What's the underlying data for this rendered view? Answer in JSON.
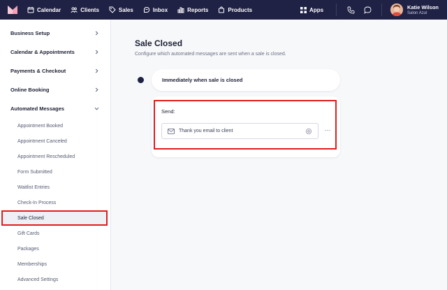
{
  "nav": {
    "items": [
      {
        "label": "Calendar",
        "icon": "calendar-icon"
      },
      {
        "label": "Clients",
        "icon": "users-icon"
      },
      {
        "label": "Sales",
        "icon": "tag-icon"
      },
      {
        "label": "Inbox",
        "icon": "inbox-icon"
      },
      {
        "label": "Reports",
        "icon": "bar-chart-icon"
      },
      {
        "label": "Products",
        "icon": "bag-icon"
      }
    ],
    "apps_label": "Apps",
    "user": {
      "name": "Katie Wilson",
      "business": "Salon Azul"
    }
  },
  "sidebar": {
    "sections": [
      {
        "label": "Business Setup"
      },
      {
        "label": "Calendar & Appointments"
      },
      {
        "label": "Payments & Checkout"
      },
      {
        "label": "Online Booking"
      },
      {
        "label": "Automated Messages"
      }
    ],
    "sub_items": [
      {
        "label": "Appointment Booked"
      },
      {
        "label": "Appointment Canceled"
      },
      {
        "label": "Appointment Rescheduled"
      },
      {
        "label": "Form Submitted"
      },
      {
        "label": "Waitlist Entries"
      },
      {
        "label": "Check-In Process"
      },
      {
        "label": "Sale Closed"
      },
      {
        "label": "Gift Cards"
      },
      {
        "label": "Packages"
      },
      {
        "label": "Memberships"
      },
      {
        "label": "Advanced Settings"
      }
    ],
    "active_item": "Sale Closed"
  },
  "main": {
    "title": "Sale Closed",
    "description": "Configure which automated messages are sent when a sale is closed.",
    "trigger_label": "Immediately when sale is closed",
    "send_label": "Send:",
    "message": "Thank you email to client",
    "more_label": "···"
  },
  "colors": {
    "nav_bg": "#1f2145",
    "highlight": "#e21b1b",
    "active_bg": "#eef0f6"
  }
}
